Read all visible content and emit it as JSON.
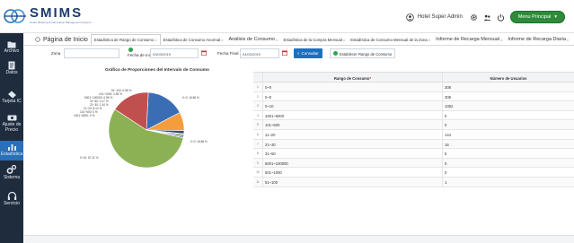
{
  "header": {
    "logo_title": "SMIMS",
    "logo_sub": "Smart Metering & Information Management System",
    "user": "Hotel Super Admin",
    "menu_label": "Menu Principal",
    "brand_green": "#2e8b3a"
  },
  "sidebar": {
    "items": [
      {
        "label": "Archivo",
        "icon": "folder-icon"
      },
      {
        "label": "Datos",
        "icon": "document-icon"
      },
      {
        "label": "Tarjeta IC",
        "icon": "card-icon"
      },
      {
        "label": "Ajuste de Precio",
        "icon": "price-tag-icon"
      },
      {
        "label": "Estadística",
        "icon": "bar-chart-icon"
      },
      {
        "label": "Sistema",
        "icon": "gears-icon"
      },
      {
        "label": "Servicio",
        "icon": "headset-icon"
      }
    ]
  },
  "tabs": {
    "home": "Página de Inicio",
    "items": [
      {
        "label": "Estadística de Rango de Consumo"
      },
      {
        "label": "Estadística de Consumo Anormal"
      },
      {
        "label": "Análisis de Consumo"
      },
      {
        "label": "Estadística de la Compra Mensual"
      },
      {
        "label": "Estadística de Consumo Mensual de la Zona"
      },
      {
        "label": "Informe de Recarga Mensual"
      },
      {
        "label": "Informe de Recarga Diaria"
      }
    ]
  },
  "filters": {
    "zona_label": "Zona",
    "fecha_inicio_label": "Fecha de Inicio",
    "fecha_inicio_value": "03/03/2019",
    "fecha_final_label": "Fecha Final",
    "fecha_final_value": "04/03/2019",
    "consultar_label": "Consultar",
    "establecer_label": "Establecer Rango de Consumo"
  },
  "chart": {
    "title": "Gráfico de Proporciones del Intervalo de Consumo",
    "labels": [
      {
        "text": "51~100: 0.55 %"
      },
      {
        "text": "101~1000: 0.55 %"
      },
      {
        "text": "5001~100000: 0.55 %"
      },
      {
        "text": "31~50: 0.17 %"
      },
      {
        "text": "21~30: 1.34 %"
      },
      {
        "text": "11~20: 8.12 %"
      },
      {
        "text": "101~500: 0 %"
      },
      {
        "text": "1001~5000: 0 %"
      },
      {
        "text": "0~0: 16.86 %"
      },
      {
        "text": "0~0: 16.86 %"
      },
      {
        "text": "0~10: 57.11 %"
      }
    ]
  },
  "chart_data": {
    "type": "pie",
    "title": "Gráfico de Proporciones del Intervalo de Consumo",
    "categories": [
      "0~0",
      "0~0",
      "0~10",
      "1001~5000",
      "101~500",
      "11~20",
      "21~30",
      "31~50",
      "5001~100000",
      "101~1000",
      "51~100"
    ],
    "values": [
      16.86,
      16.86,
      57.11,
      0,
      0,
      8.12,
      1.34,
      0.17,
      0.55,
      0.55,
      0.55
    ],
    "colors": [
      "#3b6db5",
      "#c0504d",
      "#8cb155",
      "#7d5fa6",
      "#4bacc6",
      "#f59d3d",
      "#2c4d75",
      "#9a3b38",
      "#6b8a37",
      "#5d4a7e",
      "#3b8fa8"
    ]
  },
  "table": {
    "headers": [
      "Rango de Consumo",
      "Número de Usuarios"
    ],
    "rows": [
      {
        "idx": "1",
        "rango": "0~0",
        "num": "308"
      },
      {
        "idx": "2",
        "rango": "0~0",
        "num": "308"
      },
      {
        "idx": "3",
        "rango": "0~10",
        "num": "1052"
      },
      {
        "idx": "4",
        "rango": "1001~5000",
        "num": "0"
      },
      {
        "idx": "5",
        "rango": "101~500",
        "num": "0"
      },
      {
        "idx": "6",
        "rango": "11~20",
        "num": "144"
      },
      {
        "idx": "7",
        "rango": "21~30",
        "num": "16"
      },
      {
        "idx": "8",
        "rango": "31~50",
        "num": "5"
      },
      {
        "idx": "9",
        "rango": "5001~100000",
        "num": "0"
      },
      {
        "idx": "10",
        "rango": "501~1000",
        "num": "0"
      },
      {
        "idx": "11",
        "rango": "51~100",
        "num": "1"
      }
    ]
  }
}
